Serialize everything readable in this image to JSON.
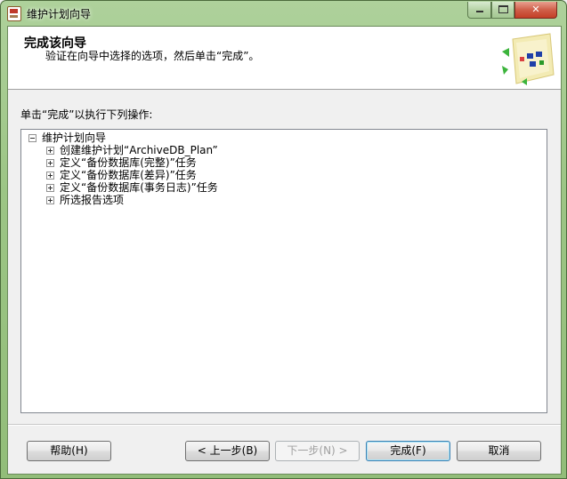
{
  "window": {
    "title": "维护计划向导"
  },
  "caption_buttons": {
    "minimize": "—",
    "maximize": "□",
    "close": "✕"
  },
  "banner": {
    "title": "完成该向导",
    "subtitle": "验证在向导中选择的选项，然后单击“完成”。"
  },
  "instruction": "单击“完成”以执行下列操作:",
  "tree": {
    "root": "维护计划向导",
    "children": [
      "创建维护计划“ArchiveDB_Plan”",
      "定义“备份数据库(完整)”任务",
      "定义“备份数据库(差异)”任务",
      "定义“备份数据库(事务日志)”任务",
      "所选报告选项"
    ]
  },
  "buttons": {
    "help": "帮助(H)",
    "back": "< 上一步(B)",
    "next": "下一步(N) >",
    "finish": "完成(F)",
    "cancel": "取消"
  }
}
